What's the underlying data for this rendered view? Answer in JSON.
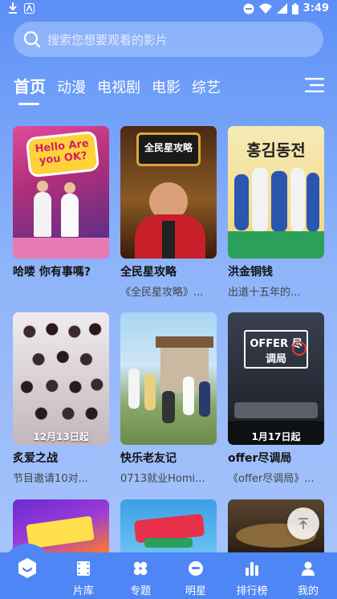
{
  "status_bar": {
    "time": "3:49"
  },
  "search": {
    "placeholder": "搜索您想要观看的影片"
  },
  "tabs": [
    {
      "label": "首页",
      "active": true
    },
    {
      "label": "动漫",
      "active": false
    },
    {
      "label": "电视剧",
      "active": false
    },
    {
      "label": "电影",
      "active": false
    },
    {
      "label": "综艺",
      "active": false
    }
  ],
  "cards": [
    {
      "title": "哈喽 你有事嗎?",
      "subtitle": "",
      "poster_text": "Hello Are you OK?",
      "poster_colors": [
        "#c93a8c",
        "#3a2a7a"
      ]
    },
    {
      "title": "全民星攻略",
      "subtitle": "《全民星攻略》...",
      "poster_text": "全民星攻略",
      "poster_colors": [
        "#6b3a1a",
        "#b8862c"
      ]
    },
    {
      "title": "洪金铜钱",
      "subtitle": "出道十五年的...",
      "poster_text": "홍김동전",
      "poster_colors": [
        "#f3e3a6",
        "#e9b93b"
      ]
    },
    {
      "title": "炙爱之战",
      "subtitle": "节目邀请10对...",
      "poster_text": "",
      "poster_date": "12月13日起",
      "poster_colors": [
        "#e9e2e4",
        "#b9a9b0"
      ]
    },
    {
      "title": "快乐老友记",
      "subtitle": "0713就业Homi...",
      "poster_text": "",
      "poster_colors": [
        "#9fcdf0",
        "#6a8d4a"
      ]
    },
    {
      "title": "offer尽调局",
      "subtitle": "《offer尽调局》...",
      "poster_text": "OFFER 尽调局",
      "poster_date": "1月17日起",
      "poster_colors": [
        "#2e3340",
        "#14161c"
      ]
    },
    {
      "title": "",
      "subtitle": "",
      "poster_text": "",
      "poster_colors": [
        "#6a2bd0",
        "#ff7a2b"
      ]
    },
    {
      "title": "",
      "subtitle": "",
      "poster_text": "",
      "poster_colors": [
        "#3aa0e8",
        "#e8304a"
      ]
    },
    {
      "title": "",
      "subtitle": "",
      "poster_text": "",
      "poster_colors": [
        "#3a2a1a",
        "#8a6a3a"
      ]
    }
  ],
  "bottom_nav": [
    {
      "label": "",
      "icon": "home-icon",
      "active": true
    },
    {
      "label": "片库",
      "icon": "film-icon"
    },
    {
      "label": "专题",
      "icon": "topics-icon"
    },
    {
      "label": "明星",
      "icon": "star-face-icon"
    },
    {
      "label": "排行榜",
      "icon": "ranking-icon"
    },
    {
      "label": "我的",
      "icon": "user-icon"
    }
  ]
}
